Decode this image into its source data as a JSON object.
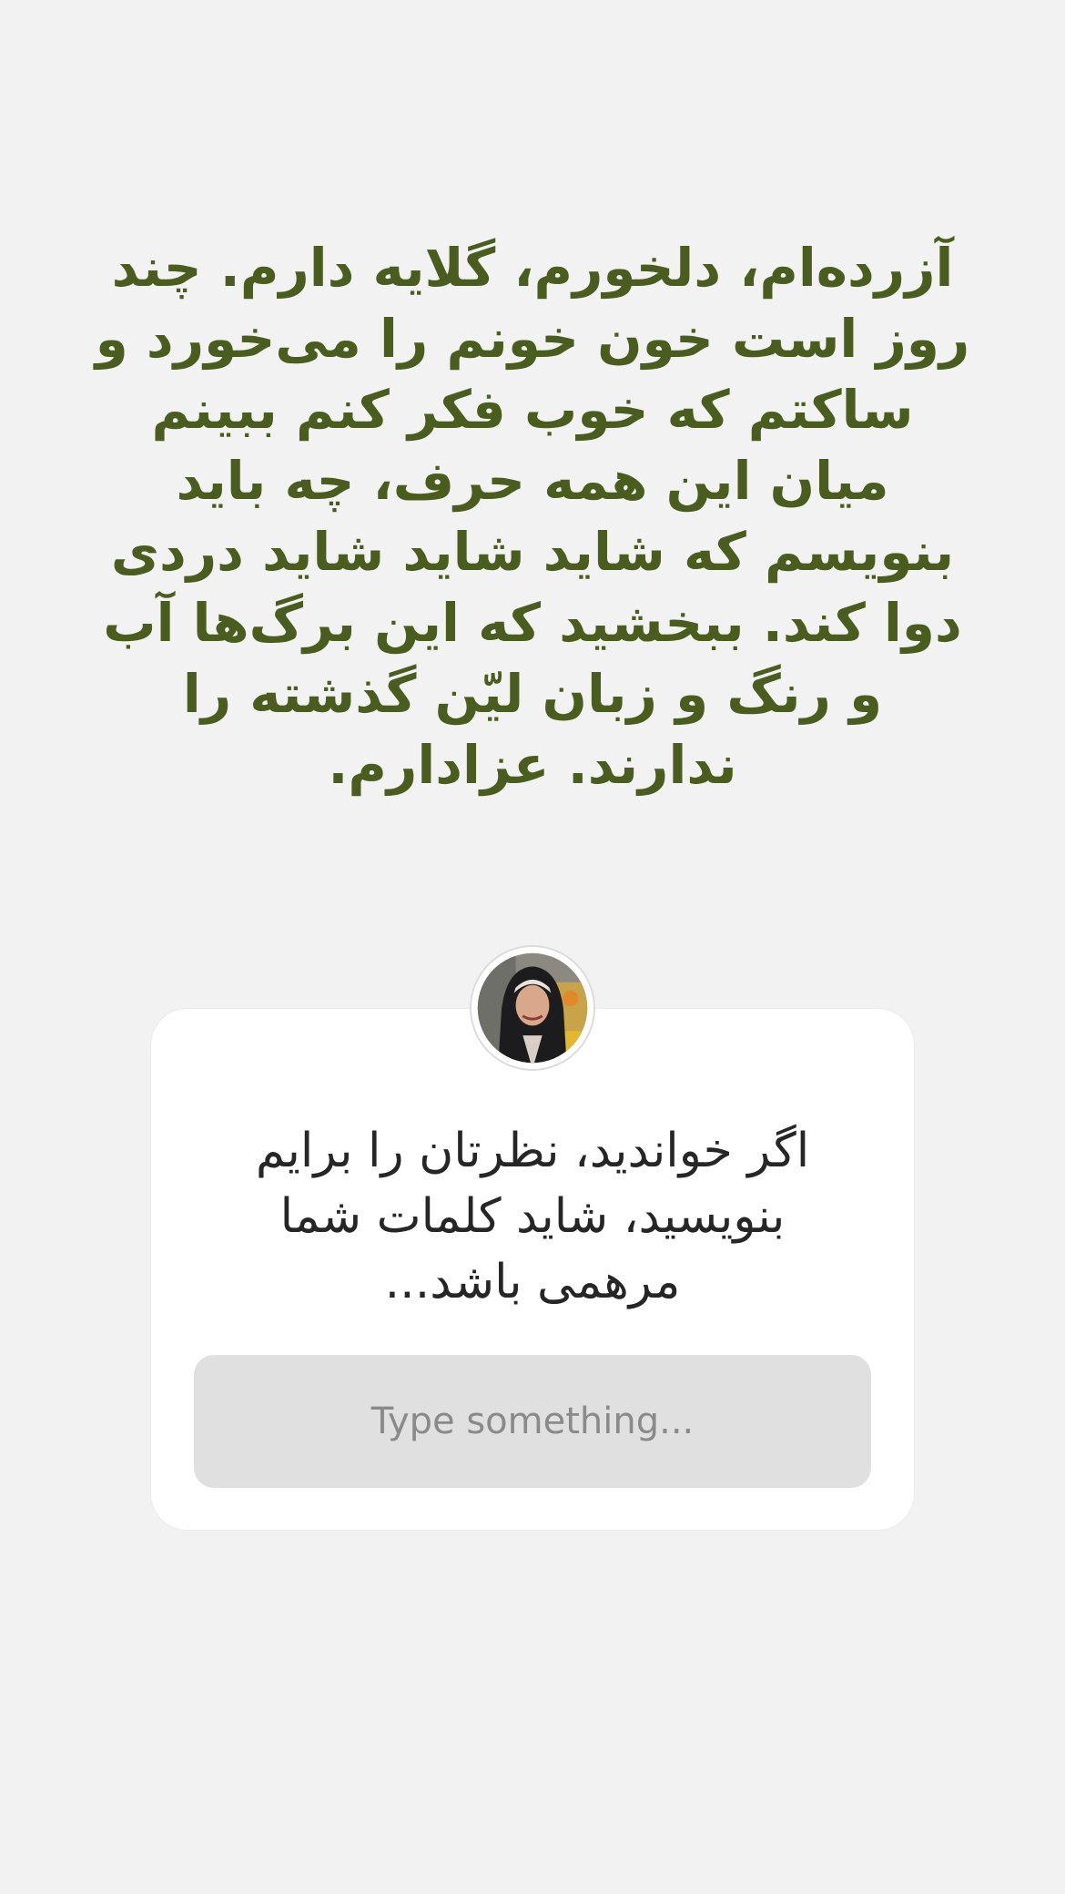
{
  "story": {
    "text": "آزرده‌ام، دلخورم، گلایه دارم. چند روز است خون خونم را می‌خورد و ساکتم که خوب فکر کنم ببینم میان این همه حرف، چه باید بنویسم که شاید شاید شاید دردی دوا کند. ببخشید که این برگ‌ها آب و رنگ و زبان لیّن گذشته را ندارند. عزادارم."
  },
  "question_sticker": {
    "avatar_icon": "profile-photo",
    "prompt": "اگر خواندید، نظرتان را برایم بنویسید، شاید کلمات شما مرهمی باشد...",
    "input_placeholder": "Type something..."
  },
  "colors": {
    "background": "#f2f2f2",
    "story_text": "#4a5d1e",
    "card": "#ffffff",
    "input_bg": "#e0e0e0",
    "prompt_text": "#262626",
    "placeholder": "#8a8a8a"
  }
}
